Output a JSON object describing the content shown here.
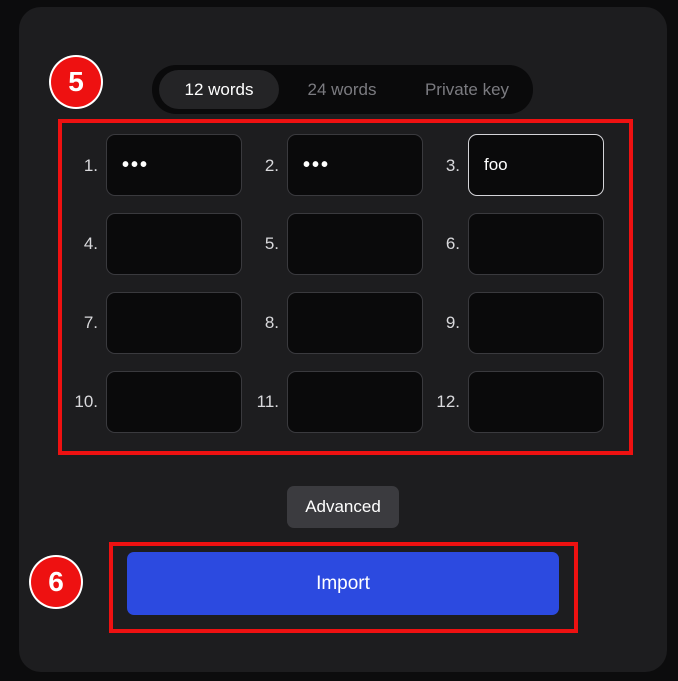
{
  "tabs": [
    {
      "label": "12 words",
      "active": true
    },
    {
      "label": "24 words",
      "active": false
    },
    {
      "label": "Private key",
      "active": false
    }
  ],
  "words": [
    {
      "label": "1.",
      "value": "•••"
    },
    {
      "label": "2.",
      "value": "•••"
    },
    {
      "label": "3.",
      "value": "foo"
    },
    {
      "label": "4.",
      "value": ""
    },
    {
      "label": "5.",
      "value": ""
    },
    {
      "label": "6.",
      "value": ""
    },
    {
      "label": "7.",
      "value": ""
    },
    {
      "label": "8.",
      "value": ""
    },
    {
      "label": "9.",
      "value": ""
    },
    {
      "label": "10.",
      "value": ""
    },
    {
      "label": "11.",
      "value": ""
    },
    {
      "label": "12.",
      "value": ""
    }
  ],
  "buttons": {
    "advanced": "Advanced",
    "import": "Import"
  },
  "annotations": {
    "badge_5": "5",
    "badge_6": "6"
  },
  "colors": {
    "accent": "#2c4ae0",
    "annotation": "#ee1111"
  }
}
